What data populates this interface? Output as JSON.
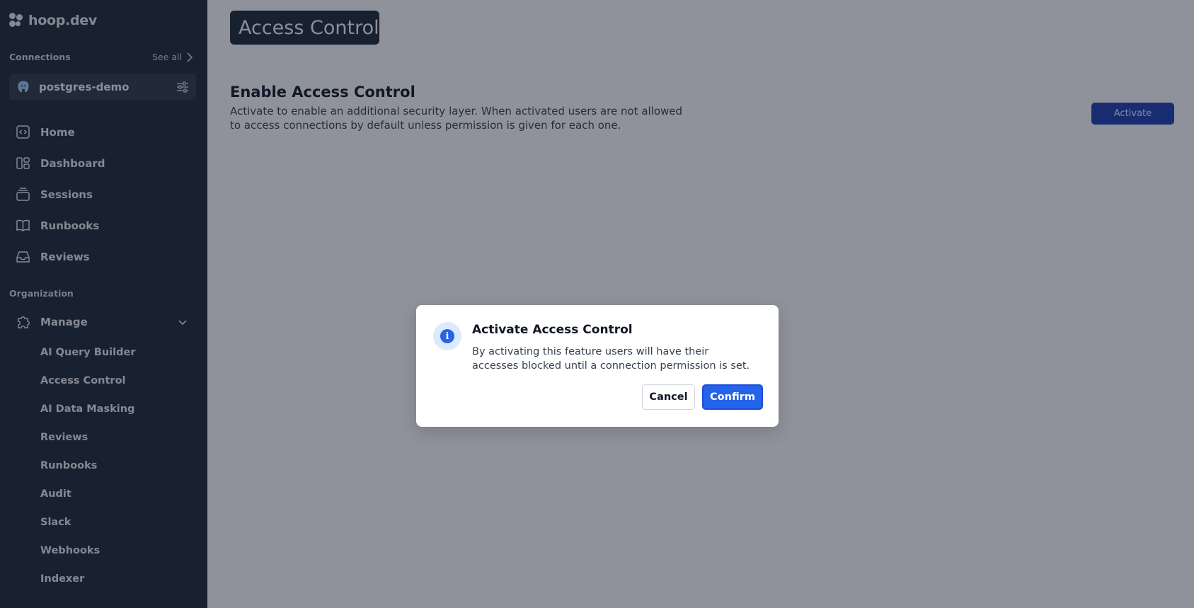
{
  "brand": {
    "name": "hoop.dev"
  },
  "sidebar": {
    "connections_label": "Connections",
    "see_all": "See all",
    "connection": {
      "name": "postgres-demo"
    },
    "nav": [
      {
        "label": "Home",
        "icon": "code-square-icon"
      },
      {
        "label": "Dashboard",
        "icon": "dashboard-icon"
      },
      {
        "label": "Sessions",
        "icon": "stack-icon"
      },
      {
        "label": "Runbooks",
        "icon": "book-icon"
      },
      {
        "label": "Reviews",
        "icon": "inbox-icon"
      }
    ],
    "organization_label": "Organization",
    "manage": {
      "label": "Manage",
      "icon": "puzzle-icon"
    },
    "manage_items": [
      "AI Query Builder",
      "Access Control",
      "AI Data Masking",
      "Reviews",
      "Runbooks",
      "Audit",
      "Slack",
      "Webhooks",
      "Indexer"
    ]
  },
  "main": {
    "page_title": "Access Control",
    "section_title": "Enable Access Control",
    "section_desc": "Activate to enable an additional security layer. When activated users are not allowed to access connections by default unless permission is given for each one.",
    "activate_label": "Activate"
  },
  "modal": {
    "title": "Activate Access Control",
    "body": "By activating this feature users will have their accesses blocked until a connection permission is set.",
    "cancel_label": "Cancel",
    "confirm_label": "Confirm",
    "info_glyph": "i"
  },
  "colors": {
    "sidebar_bg": "#1f2937",
    "primary": "#2563eb",
    "overlay": "rgba(17,24,39,0.46)"
  }
}
